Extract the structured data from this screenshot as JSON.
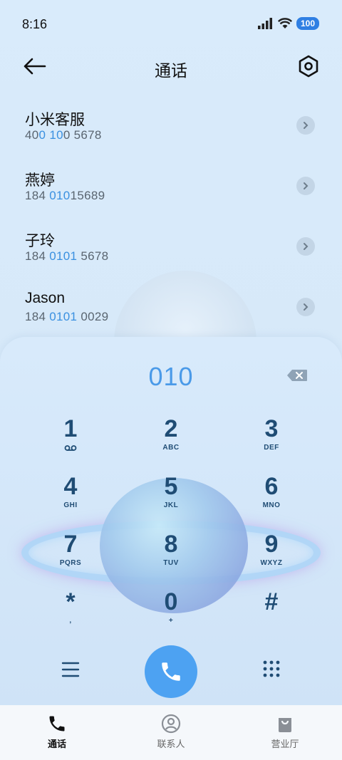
{
  "status": {
    "time": "8:16",
    "battery": "100"
  },
  "header": {
    "title": "通话"
  },
  "calls": [
    {
      "name": "小米客服",
      "pre": "40",
      "hl1": "0",
      "mid": " ",
      "hl2": "10",
      "post": "0 5678"
    },
    {
      "name": "燕婷",
      "pre": "184 ",
      "hl1": "010",
      "mid": "",
      "hl2": "",
      "post": "15689"
    },
    {
      "name": "子玲",
      "pre": "184 ",
      "hl1": "0101",
      "mid": "",
      "hl2": "",
      "post": " 5678"
    },
    {
      "name": "Jason",
      "pre": "184 ",
      "hl1": "0101",
      "mid": "",
      "hl2": "",
      "post": " 0029"
    }
  ],
  "dialpad": {
    "input": "010",
    "keys": [
      {
        "digit": "1",
        "sub": ""
      },
      {
        "digit": "2",
        "sub": "ABC"
      },
      {
        "digit": "3",
        "sub": "DEF"
      },
      {
        "digit": "4",
        "sub": "GHI"
      },
      {
        "digit": "5",
        "sub": "JKL"
      },
      {
        "digit": "6",
        "sub": "MNO"
      },
      {
        "digit": "7",
        "sub": "PQRS"
      },
      {
        "digit": "8",
        "sub": "TUV"
      },
      {
        "digit": "9",
        "sub": "WXYZ"
      },
      {
        "digit": "*",
        "sub": ","
      },
      {
        "digit": "0",
        "sub": "+"
      },
      {
        "digit": "#",
        "sub": ""
      }
    ]
  },
  "nav": {
    "items": [
      {
        "label": "通话"
      },
      {
        "label": "联系人"
      },
      {
        "label": "营业厅"
      }
    ]
  },
  "colors": {
    "accent": "#4da2f2",
    "highlight": "#3a90e0",
    "keypad_text": "#1f4c74"
  }
}
